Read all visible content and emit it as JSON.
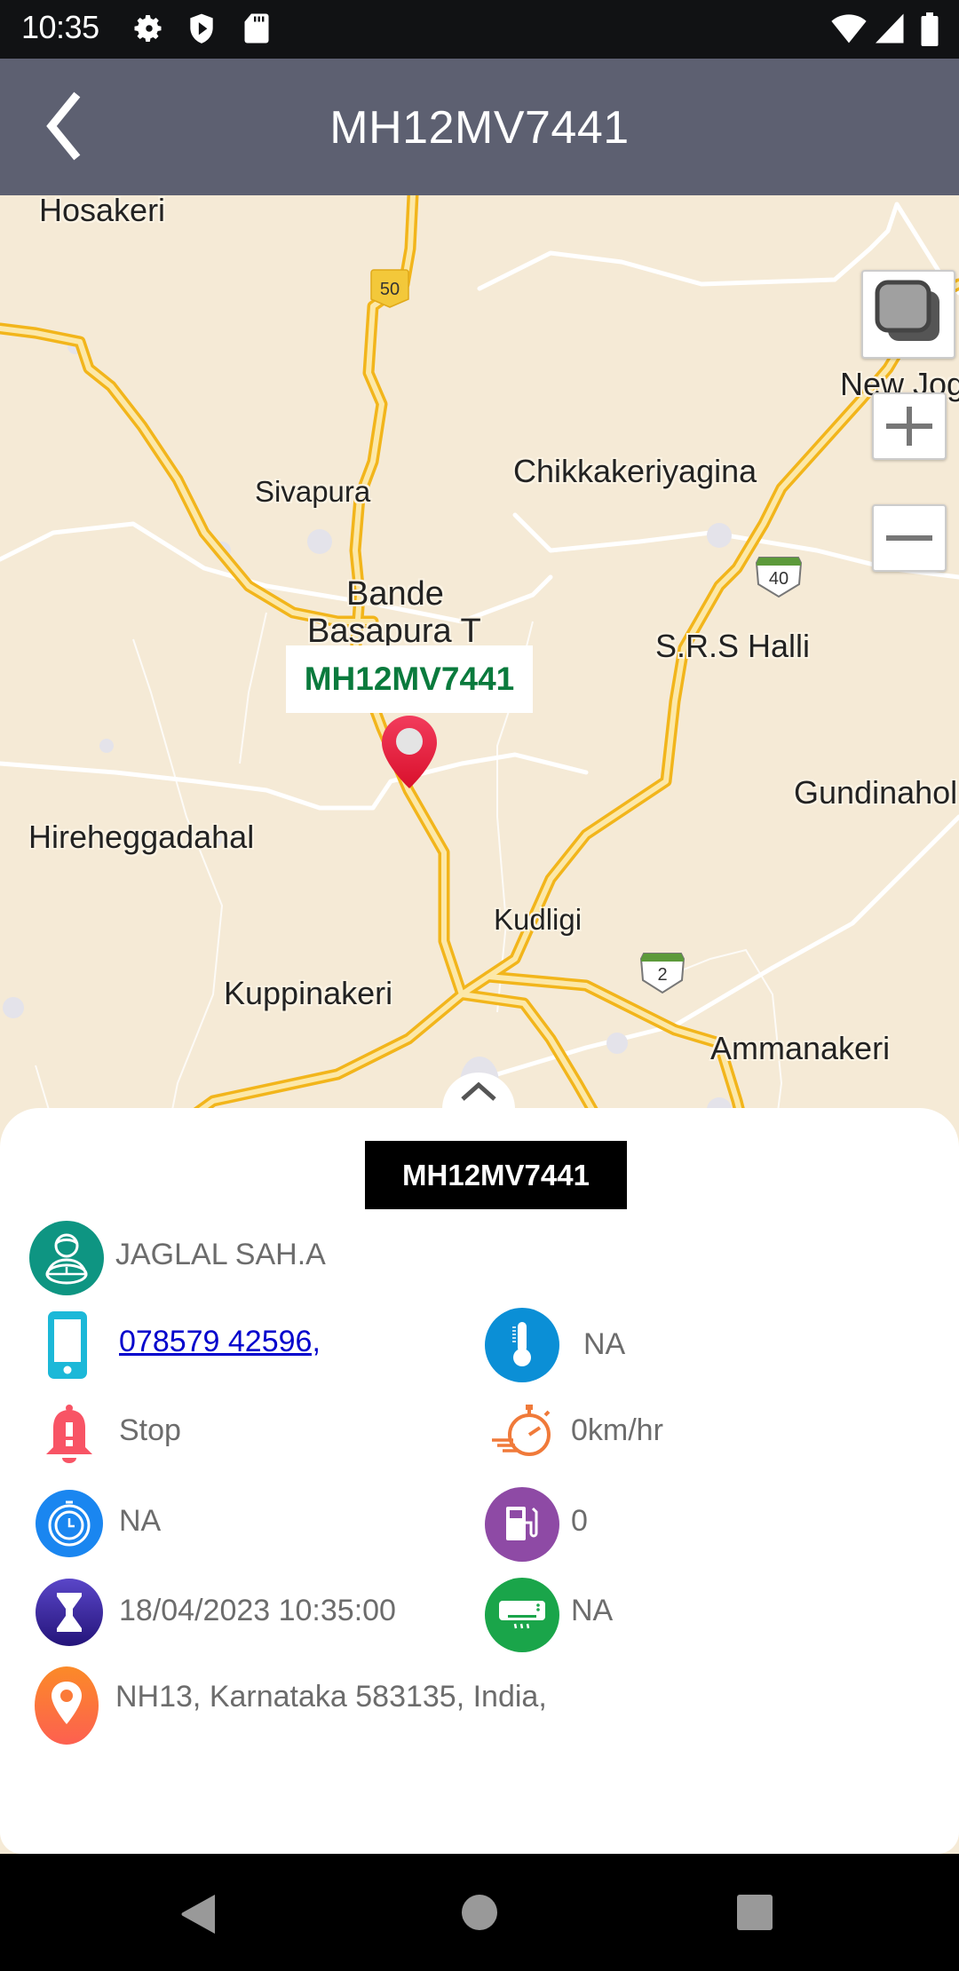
{
  "status_bar": {
    "time": "10:35",
    "left_icons": [
      "gear-icon",
      "shield-play-icon",
      "sd-card-icon"
    ],
    "right_icons": [
      "wifi-icon",
      "signal-icon",
      "battery-icon"
    ]
  },
  "app_bar": {
    "title": "MH12MV7441",
    "back_icon": "chevron-left-icon"
  },
  "map": {
    "vehicle_label": "MH12MV7441",
    "marker_color": "#e8203f",
    "places": [
      "Hosakeri",
      "Sivapura",
      "Chikkakeriyagina",
      "New Jog",
      "Bande",
      "Basapura T",
      "S.R.S Halli",
      "Gundinahol",
      "Hireheggadahal",
      "Kudligi",
      "Kuppinakeri",
      "Ammanakeri"
    ],
    "road_shields": [
      "50",
      "40",
      "2"
    ],
    "controls": {
      "layers_icon": "layers-icon",
      "zoom_in_icon": "plus-icon",
      "zoom_out_icon": "minus-icon"
    }
  },
  "sheet": {
    "expand_icon": "chevron-up-icon",
    "plate": "MH12MV7441",
    "driver_name": "JAGLAL SAH.A",
    "phone": "078579 42596,",
    "temperature": "NA",
    "status": "Stop",
    "speed": "0km/hr",
    "duration": "NA",
    "fuel": "0",
    "datetime": "18/04/2023 10:35:00",
    "ac": "NA",
    "address": "NH13, Karnataka 583135, India,",
    "colors": {
      "driver": "#0e9582",
      "phone": "#1cb8d8",
      "temperature": "#0b8fd6",
      "alert": "#f85465",
      "speed": "#f07a3a",
      "timer": "#1a86f0",
      "fuel": "#8e4aa5",
      "hourglass": "#3b2a9e",
      "ac": "#1aa54a",
      "location": "#fb7a38"
    }
  },
  "nav_bar": {
    "back_icon": "nav-back-icon",
    "home_icon": "nav-home-icon",
    "recents_icon": "nav-recents-icon"
  }
}
